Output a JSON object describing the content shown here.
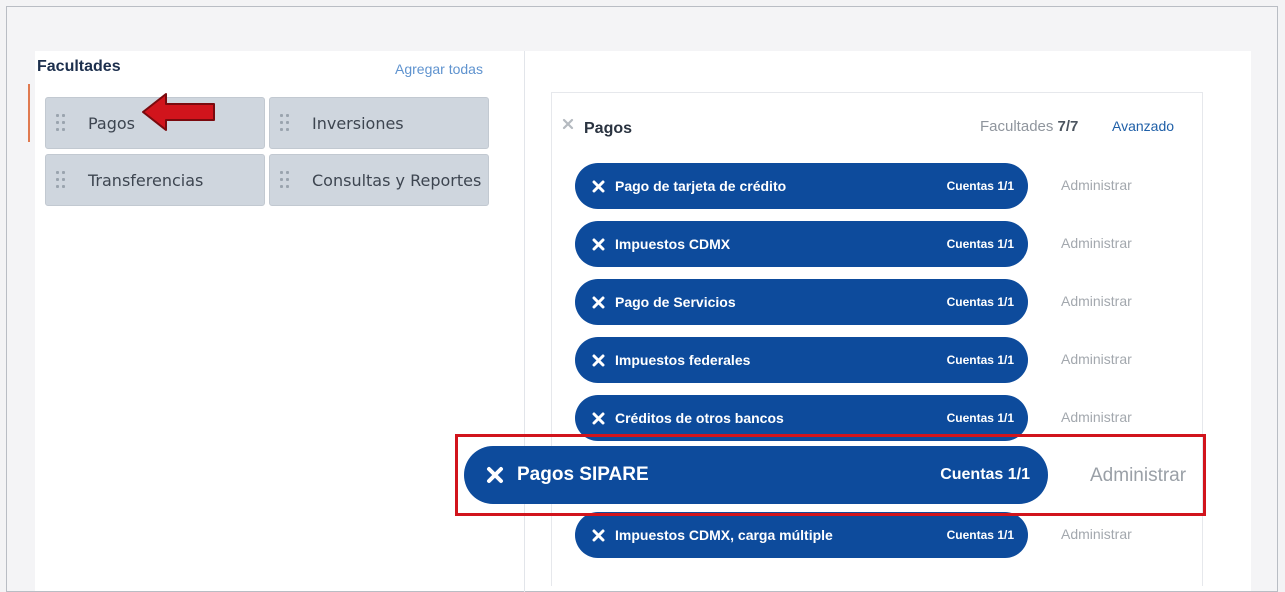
{
  "left_panel": {
    "title": "Facultades",
    "add_all_label": "Agregar todas",
    "tiles": [
      {
        "label": "Pagos"
      },
      {
        "label": "Inversiones"
      },
      {
        "label": "Transferencias"
      },
      {
        "label": "Consultas y Reportes"
      }
    ]
  },
  "right_panel": {
    "title": "Pagos",
    "permissions_label": "Facultades",
    "permissions_value": "7/7",
    "advanced_label": "Avanzado",
    "items": [
      {
        "label": "Pago de tarjeta de crédito",
        "accounts": "Cuentas 1/1",
        "action": "Administrar"
      },
      {
        "label": "Impuestos CDMX",
        "accounts": "Cuentas 1/1",
        "action": "Administrar"
      },
      {
        "label": "Pago de Servicios",
        "accounts": "Cuentas 1/1",
        "action": "Administrar"
      },
      {
        "label": "Impuestos federales",
        "accounts": "Cuentas 1/1",
        "action": "Administrar"
      },
      {
        "label": "Créditos de otros bancos",
        "accounts": "Cuentas 1/1",
        "action": "Administrar"
      },
      {
        "label": "Pagos SIPARE",
        "accounts": "Cuentas 1/1",
        "action": "Administrar"
      },
      {
        "label": "Impuestos CDMX, carga múltiple",
        "accounts": "Cuentas 1/1",
        "action": "Administrar"
      }
    ]
  },
  "icons": {
    "grip": "drag-handle-icon",
    "remove": "close-icon",
    "annotation_arrow": "arrow-left-icon"
  },
  "colors": {
    "pill_blue": "#0d4b9c",
    "tile_grey": "#cfd6de",
    "annotation_red": "#d1141c",
    "link_blue": "#5f93cf"
  }
}
